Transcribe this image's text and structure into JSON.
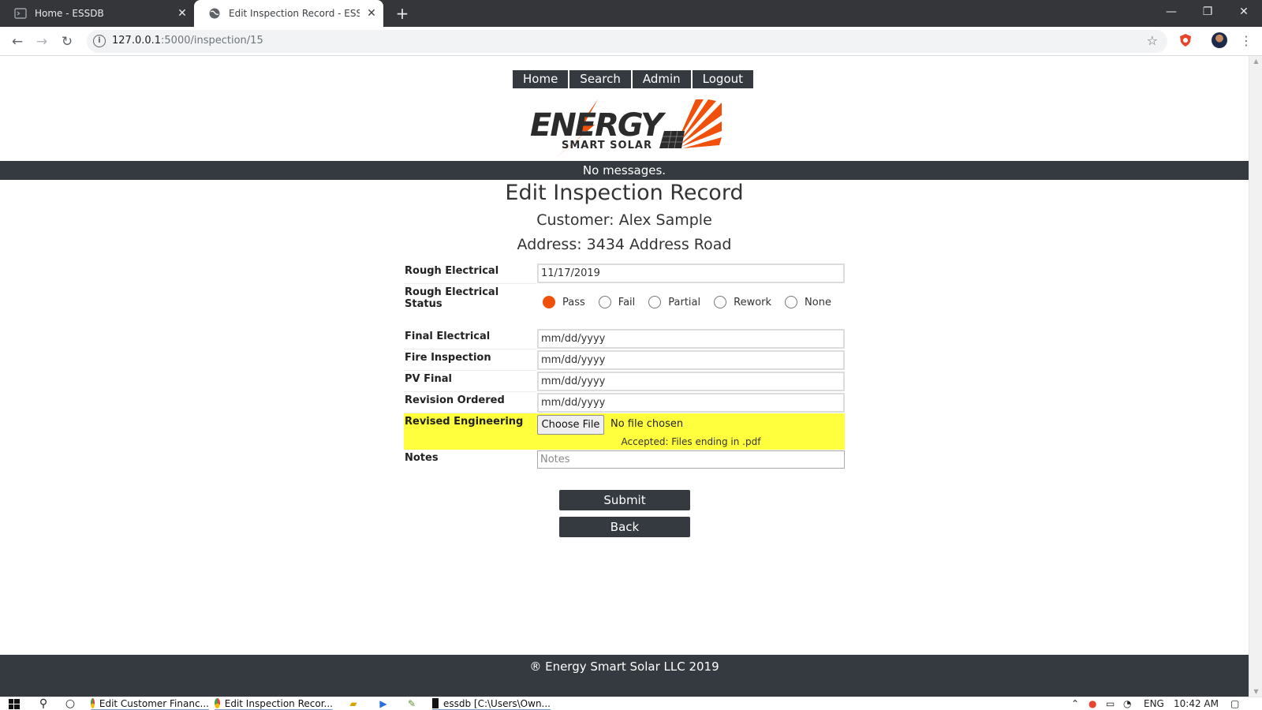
{
  "browser": {
    "tabs": [
      {
        "title": "Home - ESSDB",
        "active": false
      },
      {
        "title": "Edit Inspection Record - ESSDB",
        "active": true
      }
    ],
    "new_tab_label": "+",
    "url_host": "127.0.0.1",
    "url_rest": ":5000/inspection/15",
    "window_controls": {
      "minimize": "—",
      "restore": "❐",
      "close": "✕"
    }
  },
  "nav": {
    "items": [
      "Home",
      "Search",
      "Admin",
      "Logout"
    ]
  },
  "logo": {
    "line1": "ENERGY",
    "line2": "SMART SOLAR",
    "accent_color": "#f0500a"
  },
  "messages": "No messages.",
  "page": {
    "title": "Edit Inspection Record",
    "customer": "Customer: Alex Sample",
    "address": "Address: 3434 Address Road"
  },
  "form": {
    "rough_electrical": {
      "label": "Rough Electrical",
      "value": "11/17/2019"
    },
    "rough_status": {
      "label": "Rough Electrical Status",
      "options": [
        "Pass",
        "Fail",
        "Partial",
        "Rework",
        "None"
      ],
      "selected": "Pass"
    },
    "final_electrical": {
      "label": "Final Electrical",
      "placeholder": "mm/dd/yyyy"
    },
    "fire_inspection": {
      "label": "Fire Inspection",
      "placeholder": "mm/dd/yyyy"
    },
    "pv_final": {
      "label": "PV Final",
      "placeholder": "mm/dd/yyyy"
    },
    "revision_ordered": {
      "label": "Revision Ordered",
      "placeholder": "mm/dd/yyyy"
    },
    "revised_engineering": {
      "label": "Revised Engineering",
      "button": "Choose File",
      "status": "No file chosen",
      "accepted": "Accepted: Files ending in .pdf",
      "highlight_color": "#ffff3d"
    },
    "notes": {
      "label": "Notes",
      "placeholder": "Notes"
    },
    "submit": "Submit",
    "back": "Back"
  },
  "footer": "® Energy Smart Solar LLC 2019",
  "taskbar": {
    "apps": [
      {
        "label": "Edit Customer Financ...",
        "active": true
      },
      {
        "label": "Edit Inspection Recor...",
        "active": true
      },
      {
        "label": "essdb [C:\\Users\\Own...",
        "active": true
      }
    ],
    "language": "ENG",
    "time": "10:42 AM"
  }
}
